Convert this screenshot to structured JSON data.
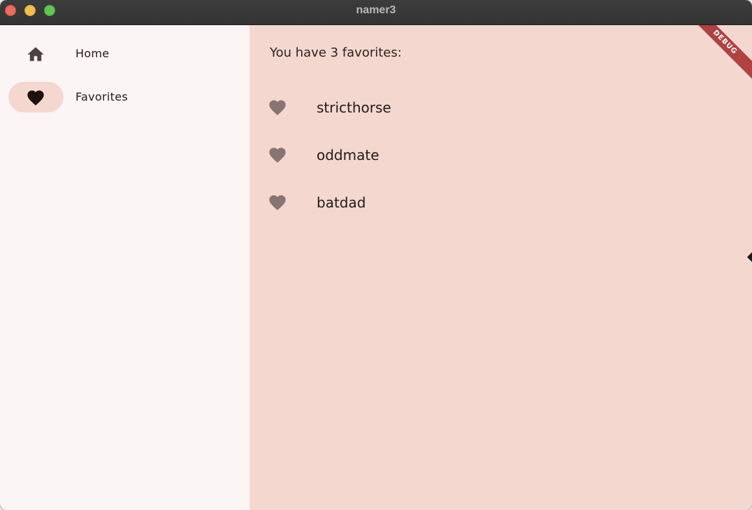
{
  "window": {
    "title": "namer3"
  },
  "nav": {
    "items": [
      {
        "label": "Home",
        "icon": "home-icon",
        "selected": false
      },
      {
        "label": "Favorites",
        "icon": "heart-icon",
        "selected": true
      }
    ]
  },
  "favorites": {
    "heading": "You have 3 favorites:",
    "items": [
      {
        "name": "stricthorse",
        "icon": "heart-icon"
      },
      {
        "name": "oddmate",
        "icon": "heart-icon"
      },
      {
        "name": "batdad",
        "icon": "heart-icon"
      }
    ]
  },
  "debug_banner": "DEBUG",
  "colors": {
    "rail_background": "#fcf5f5",
    "content_background": "#f4d8cf",
    "indicator": "#f4d8cf",
    "favorite_icon": "#8a7471",
    "ribbon": "#b04242"
  }
}
